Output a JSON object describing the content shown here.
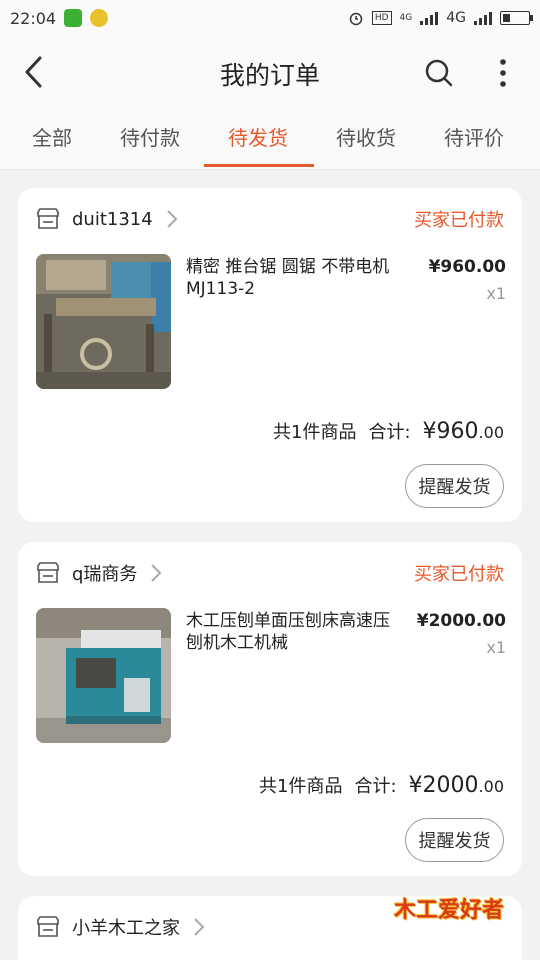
{
  "status_bar": {
    "time": "22:04",
    "hd_badge": "HD",
    "network_small": "4G",
    "network": "4G"
  },
  "header": {
    "title": "我的订单"
  },
  "tabs": [
    {
      "label": "全部"
    },
    {
      "label": "待付款"
    },
    {
      "label": "待发货",
      "active": true
    },
    {
      "label": "待收货"
    },
    {
      "label": "待评价"
    }
  ],
  "orders": [
    {
      "shop": "duit1314",
      "status": "买家已付款",
      "item_title": "精密 推台锯 圆锯 不带电机MJ113-2",
      "price": "¥960.00",
      "qty": "x1",
      "count_text": "共1件商品",
      "total_label": "合计:",
      "total_main": "¥960",
      "total_cents": ".00",
      "action": "提醒发货"
    },
    {
      "shop": "q瑞商务",
      "status": "买家已付款",
      "item_title": "木工压刨单面压刨床高速压刨机木工机械",
      "price": "¥2000.00",
      "qty": "x1",
      "count_text": "共1件商品",
      "total_label": "合计:",
      "total_main": "¥2000",
      "total_cents": ".00",
      "action": "提醒发货"
    },
    {
      "shop": "小羊木工之家"
    }
  ],
  "watermark": {
    "logo": "木工爱好者"
  },
  "colors": {
    "accent": "#e8582a",
    "background": "#f2f2f2"
  }
}
